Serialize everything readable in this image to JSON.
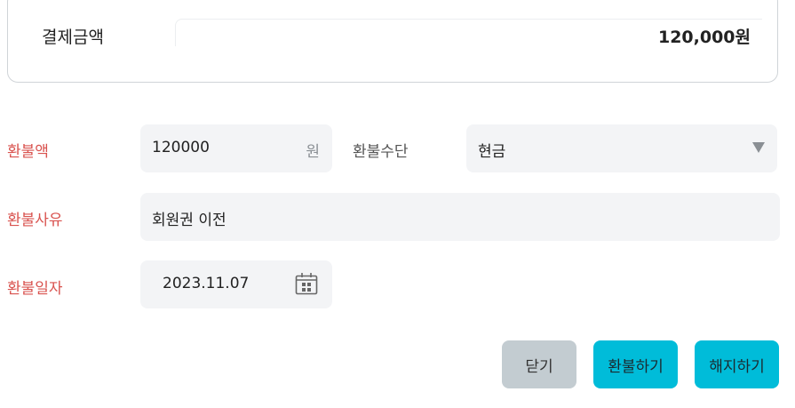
{
  "summary": {
    "payment_label": "결제금액",
    "payment_value": "120,000원"
  },
  "refund_amount": {
    "label": "환불액",
    "value": "120000",
    "unit": "원"
  },
  "refund_method": {
    "label": "환불수단",
    "selected": "현금"
  },
  "refund_reason": {
    "label": "환불사유",
    "value": "회원권 이전"
  },
  "refund_date": {
    "label": "환불일자",
    "value": "2023.11.07"
  },
  "buttons": {
    "close": "닫기",
    "refund": "환불하기",
    "terminate": "해지하기"
  },
  "colors": {
    "required_label": "#d9534f",
    "primary_button": "#00bcd9",
    "secondary_button": "#c3ccd1",
    "field_bg": "#f3f4f6"
  },
  "icons": {
    "dropdown": "triangle-down-icon",
    "date": "calendar-icon"
  }
}
